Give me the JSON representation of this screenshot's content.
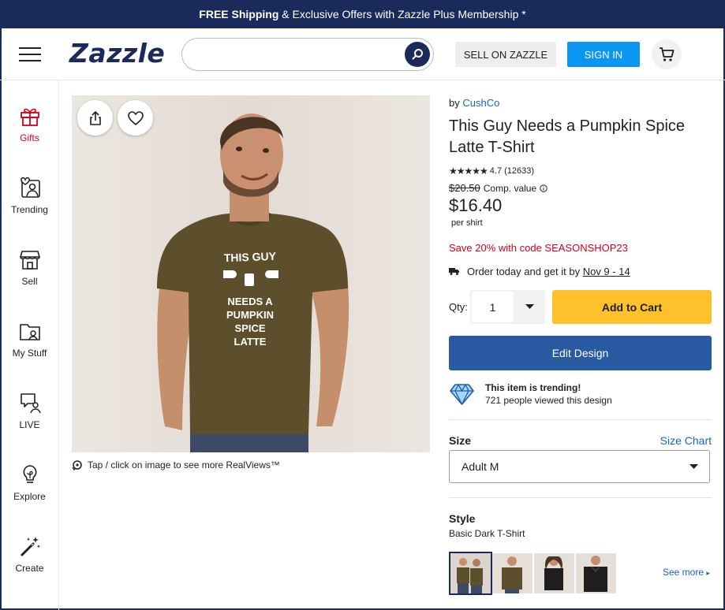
{
  "promo_bar": {
    "bold": "FREE Shipping",
    "rest": " & Exclusive Offers with Zazzle Plus Membership *"
  },
  "header": {
    "logo": "Zazzle",
    "search_placeholder": "",
    "sell_label": "SELL ON ZAZZLE",
    "signin_label": "SIGN IN"
  },
  "sidebar": {
    "items": [
      {
        "label": "Gifts",
        "icon": "gift-icon"
      },
      {
        "label": "Trending",
        "icon": "trending-icon"
      },
      {
        "label": "Sell",
        "icon": "storefront-icon"
      },
      {
        "label": "My Stuff",
        "icon": "folder-icon"
      },
      {
        "label": "LIVE",
        "icon": "live-chat-icon"
      },
      {
        "label": "Explore",
        "icon": "lightbulb-icon"
      },
      {
        "label": "Create",
        "icon": "magic-wand-icon"
      }
    ]
  },
  "product_image": {
    "shirt_text": [
      "THIS GUY",
      "NEEDS A",
      "PUMPKIN",
      "SPICE",
      "LATTE"
    ],
    "realview_hint": "Tap / click on image to see more RealViews™"
  },
  "product": {
    "by_label": "by ",
    "seller": "CushCo",
    "title": "This Guy Needs a Pumpkin Spice Latte T-Shirt",
    "rating": "4.7",
    "review_count": "(12633)",
    "old_price": "$20.50",
    "comp_label": "Comp. value",
    "price": "$16.40",
    "per_unit": "per shirt",
    "promo_code": "Save 20% with code SEASONSHOP23",
    "delivery_prefix": "Order today and get it by ",
    "delivery_date": "Nov 9 - 14",
    "qty_label": "Qty:",
    "qty_value": "1",
    "add_to_cart": "Add to Cart",
    "edit_design": "Edit Design",
    "trending_title": "This item is trending!",
    "trending_sub": "721 people viewed this design",
    "size_label": "Size",
    "size_chart": "Size Chart",
    "size_value": "Adult M",
    "style_label": "Style",
    "style_value": "Basic Dark T-Shirt",
    "see_more": "See more"
  },
  "colors": {
    "navy": "#1a2a5a",
    "signin_blue": "#0b96f3",
    "cart_yellow": "#ffc12b",
    "edit_blue": "#2a5aa2",
    "promo_red": "#d0021b",
    "link_blue": "#1865c4",
    "shirt_brown": "#5e4f2c"
  }
}
